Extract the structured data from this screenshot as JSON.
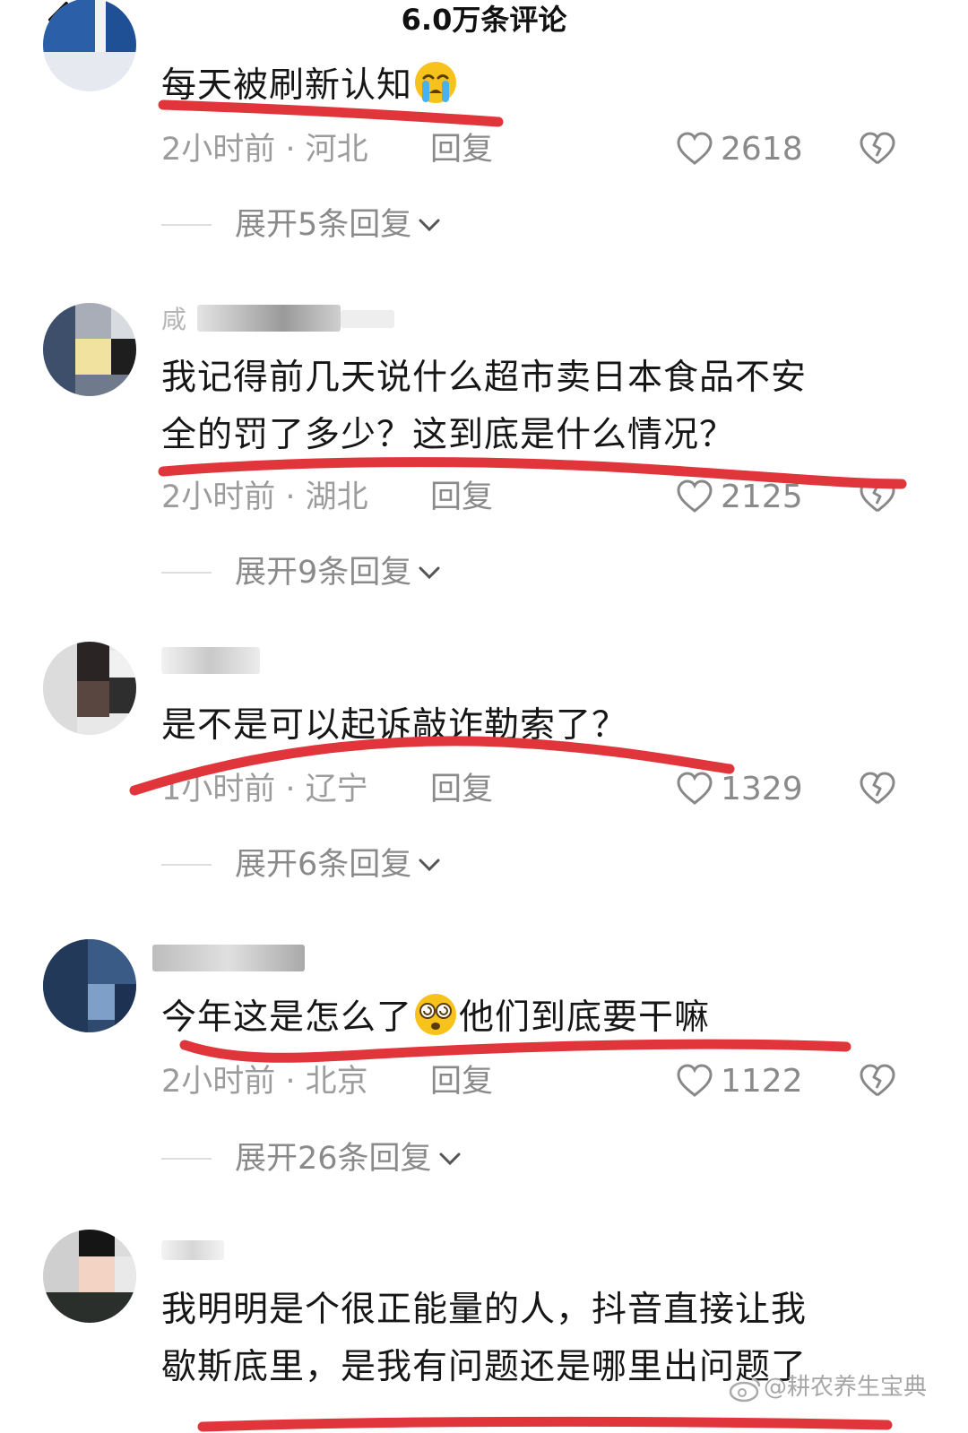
{
  "header": {
    "title": "6.0万条评论"
  },
  "comments": [
    {
      "username": "",
      "text": "每天被刷新认知",
      "emoji": "loudly-crying-face",
      "time_location": "2小时前 · 河北",
      "reply_label": "回复",
      "likes": "2618",
      "expand_label": "展开5条回复"
    },
    {
      "username": "咸",
      "text_line1": "我记得前几天说什么超市卖日本食品不安",
      "text_line2": "全的罚了多少？这到底是什么情况？",
      "time_location": "2小时前 · 湖北",
      "reply_label": "回复",
      "likes": "2125",
      "expand_label": "展开9条回复"
    },
    {
      "username": "",
      "text": "是不是可以起诉敲诈勒索了？",
      "time_location": "1小时前 · 辽宁",
      "reply_label": "回复",
      "likes": "1329",
      "expand_label": "展开6条回复"
    },
    {
      "username": "",
      "text_before": "今年这是怎么了",
      "emoji": "dizzy-face",
      "text_after": "他们到底要干嘛",
      "time_location": "2小时前 · 北京",
      "reply_label": "回复",
      "likes": "1122",
      "expand_label": "展开26条回复"
    },
    {
      "username": "",
      "text_line1": "我明明是个很正能量的人，抖音直接让我",
      "text_line2": "歇斯底里，是我有问题还是哪里出问题了"
    }
  ],
  "watermark": "@耕农养生宝典",
  "icons": {
    "back": "chevron-left-icon",
    "like": "heart-outline-icon",
    "dislike": "broken-heart-icon",
    "expand": "chevron-down-icon",
    "watermark": "weibo-logo-icon"
  },
  "colors": {
    "underline": "#e0353b",
    "meta_text": "#9c9c9c",
    "body_text": "#161616"
  }
}
